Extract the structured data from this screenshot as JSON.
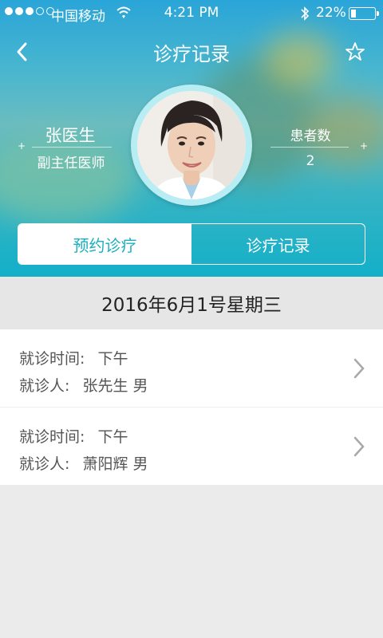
{
  "status_bar": {
    "carrier": "中国移动",
    "time": "4:21 PM",
    "battery": "22%",
    "battery_level": 0.22
  },
  "nav": {
    "title": "诊疗记录",
    "back_icon": "chevron-left-icon",
    "favorite_icon": "star-outline-icon"
  },
  "doctor": {
    "name": "张医生",
    "title": "副主任医师",
    "patients_label": "患者数",
    "patients_count": "2"
  },
  "tabs": [
    {
      "label": "预约诊疗",
      "active": true
    },
    {
      "label": "诊疗记录",
      "active": false
    }
  ],
  "date": "2016年6月1号星期三",
  "records": [
    {
      "time_label": "就诊时间:",
      "time_value": "下午",
      "patient_label": "就诊人:",
      "patient_value": "张先生 男"
    },
    {
      "time_label": "就诊时间:",
      "time_value": "下午",
      "patient_label": "就诊人:",
      "patient_value": "萧阳辉 男"
    }
  ],
  "colors": {
    "accent": "#1bb0be",
    "header_top": "#2aa5d8",
    "header_bottom": "#13b0c8",
    "page_bg": "#ebebeb"
  }
}
